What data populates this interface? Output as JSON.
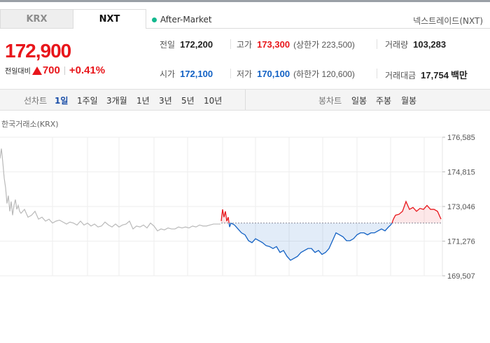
{
  "market_tabs": [
    "KRX",
    "NXT"
  ],
  "session": "After-Market",
  "trader_label": "넥스트레이드(NXT)",
  "quote": {
    "price": "172,900",
    "change_label": "전일대비",
    "change": "700",
    "change_pct": "+0.41%"
  },
  "stats": {
    "prev_close": {
      "label": "전일",
      "value": "172,200"
    },
    "high": {
      "label": "고가",
      "value": "173,300",
      "sub": "(상한가 223,500)"
    },
    "volume": {
      "label": "거래량",
      "value": "103,283"
    },
    "open": {
      "label": "시가",
      "value": "172,100"
    },
    "low": {
      "label": "저가",
      "value": "170,100",
      "sub": "(하한가 120,600)"
    },
    "amount": {
      "label": "거래대금",
      "value": "17,754",
      "unit": "백만"
    }
  },
  "toolbar": {
    "line_label": "선차트",
    "line_periods": [
      "1일",
      "1주일",
      "3개월",
      "1년",
      "3년",
      "5년",
      "10년"
    ],
    "active_period": "1일",
    "candle_label": "봉차트",
    "candle_periods": [
      "일봉",
      "주봉",
      "월봉"
    ]
  },
  "chart_title": "한국거래소(KRX)",
  "colors": {
    "up": "#e8161b",
    "down": "#1261c4",
    "krx_line": "#b9b9b9"
  },
  "chart_data": {
    "type": "line",
    "ylim": [
      169507,
      176585
    ],
    "y_ticks": [
      "176,585",
      "174,815",
      "173,046",
      "171,276",
      "169,507"
    ],
    "y_tick_values": [
      176585,
      174815,
      173046,
      171276,
      169507
    ],
    "baseline": 172200,
    "series": [
      {
        "name": "한국거래소(KRX)",
        "x": [
          0,
          2,
          4,
          6,
          8,
          10,
          12,
          14,
          16,
          18,
          20,
          22,
          24,
          26,
          28,
          30,
          35,
          40,
          45,
          50,
          55,
          60,
          65,
          70,
          75,
          80,
          85,
          90,
          95,
          100,
          105,
          110,
          115,
          120,
          125,
          130,
          135,
          140,
          145,
          150,
          155,
          160,
          165,
          170,
          175,
          180,
          185,
          190,
          195,
          200,
          205,
          210,
          215,
          220,
          225,
          230,
          235,
          240,
          245,
          250,
          255,
          260,
          265,
          270,
          275,
          280,
          285,
          290,
          295,
          300,
          305,
          310,
          315
        ],
        "y": [
          175500,
          176000,
          175300,
          174500,
          174000,
          173200,
          173600,
          172800,
          173300,
          172600,
          173100,
          173400,
          172900,
          173100,
          172800,
          172700,
          172900,
          172500,
          172600,
          172800,
          172400,
          172500,
          172300,
          172400,
          172200,
          172300,
          172350,
          172250,
          172150,
          172250,
          172200,
          172100,
          172300,
          172100,
          172200,
          172050,
          172150,
          172000,
          172050,
          172250,
          172100,
          172000,
          172150,
          172000,
          172100,
          172150,
          172300,
          171900,
          172050,
          172000,
          172100,
          171950,
          172200,
          172050,
          171800,
          171900,
          171850,
          171950,
          171900,
          171900,
          172000,
          171950,
          172000,
          171950,
          172050,
          172000,
          172100,
          172050,
          172050,
          172100,
          172150,
          172150,
          172150
        ]
      },
      {
        "name": "NXT",
        "x": [
          316,
          318,
          320,
          322,
          324,
          326,
          328,
          330,
          335,
          340,
          345,
          350,
          355,
          360,
          365,
          370,
          375,
          380,
          385,
          390,
          395,
          400,
          405,
          410,
          415,
          420,
          425,
          430,
          435,
          440,
          445,
          450,
          455,
          460,
          465,
          470,
          475,
          480,
          485,
          490,
          495,
          500,
          505,
          510,
          515,
          520,
          525,
          530,
          535,
          540,
          545,
          550,
          555,
          558,
          560,
          562,
          565,
          570,
          575,
          580,
          585,
          590,
          595,
          600,
          605,
          610,
          615,
          620,
          625,
          630
        ],
        "y": [
          172300,
          172900,
          172500,
          172800,
          172300,
          172500,
          172000,
          172200,
          172100,
          171900,
          171700,
          171600,
          171300,
          171200,
          171400,
          171300,
          171200,
          171050,
          171000,
          170900,
          171000,
          170700,
          170800,
          170500,
          170300,
          170400,
          170500,
          170700,
          170800,
          170900,
          170900,
          170700,
          170800,
          170600,
          170700,
          170900,
          171300,
          171700,
          171600,
          171500,
          171300,
          171300,
          171400,
          171600,
          171700,
          171700,
          171600,
          171700,
          171700,
          171800,
          171900,
          171800,
          172000,
          172100,
          172200,
          172400,
          172600,
          172650,
          172800,
          173300,
          172900,
          173000,
          172800,
          172950,
          172900,
          173100,
          172900,
          172900,
          172800,
          172400
        ]
      }
    ],
    "xlabel": "",
    "ylabel": ""
  }
}
